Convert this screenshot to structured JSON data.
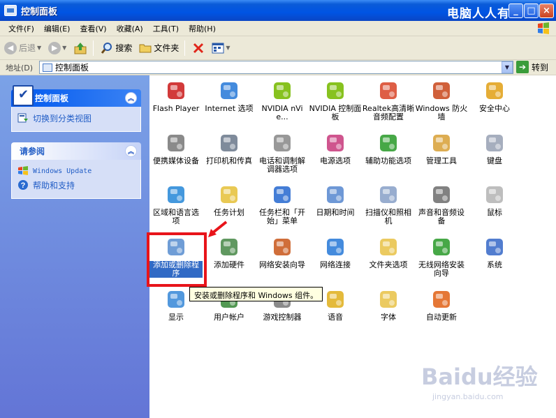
{
  "window": {
    "title": "控制面板",
    "watermark": "电脑人人有",
    "buttons": [
      "_",
      "□",
      "×"
    ]
  },
  "menu": [
    "文件(F)",
    "编辑(E)",
    "查看(V)",
    "收藏(A)",
    "工具(T)",
    "帮助(H)"
  ],
  "toolbar": {
    "back": "后退",
    "search": "搜索",
    "folders": "文件夹"
  },
  "address": {
    "label": "地址(D)",
    "value": "控制面板",
    "go": "转到"
  },
  "sidebar": {
    "panel1": {
      "title": "控制面板",
      "link": "切换到分类视图"
    },
    "panel2": {
      "title": "请参阅",
      "links": [
        "Windows Update",
        "帮助和支持"
      ]
    }
  },
  "items": [
    {
      "label": "Flash Player",
      "icon": "flash-icon",
      "color": "#cc1f1f"
    },
    {
      "label": "Internet 选项",
      "icon": "internet-options-icon",
      "color": "#2a7bd8"
    },
    {
      "label": "NVIDIA nVie...",
      "icon": "nvidia-view-icon",
      "color": "#76b900"
    },
    {
      "label": "NVIDIA 控制面板",
      "icon": "nvidia-control-icon",
      "color": "#76b900"
    },
    {
      "label": "Realtek高清晰音频配置",
      "icon": "realtek-audio-icon",
      "color": "#d9482b"
    },
    {
      "label": "Windows 防火墙",
      "icon": "firewall-icon",
      "color": "#c94a1f"
    },
    {
      "label": "安全中心",
      "icon": "security-center-icon",
      "color": "#e1a21a"
    },
    {
      "label": "便携媒体设备",
      "icon": "portable-media-icon",
      "color": "#7a7a7a"
    },
    {
      "label": "打印机和传真",
      "icon": "printer-icon",
      "color": "#6d7b8d"
    },
    {
      "label": "电话和调制解调器选项",
      "icon": "phone-modem-icon",
      "color": "#8a8a8a"
    },
    {
      "label": "电源选项",
      "icon": "power-options-icon",
      "color": "#c83d7e"
    },
    {
      "label": "辅助功能选项",
      "icon": "accessibility-icon",
      "color": "#2d9c2d"
    },
    {
      "label": "管理工具",
      "icon": "admin-tools-icon",
      "color": "#d8a23a"
    },
    {
      "label": "键盘",
      "icon": "keyboard-icon",
      "color": "#9aa3b5"
    },
    {
      "label": "区域和语言选项",
      "icon": "region-language-icon",
      "color": "#2a8ad8"
    },
    {
      "label": "任务计划",
      "icon": "scheduled-tasks-icon",
      "color": "#e6c23c"
    },
    {
      "label": "任务栏和「开始」菜单",
      "icon": "taskbar-icon",
      "color": "#2a6bd0"
    },
    {
      "label": "日期和时间",
      "icon": "date-time-icon",
      "color": "#5a8ad0"
    },
    {
      "label": "扫描仪和照相机",
      "icon": "scanner-camera-icon",
      "color": "#8aa2c8"
    },
    {
      "label": "声音和音频设备",
      "icon": "sound-icon",
      "color": "#707070"
    },
    {
      "label": "鼠标",
      "icon": "mouse-icon",
      "color": "#b5b5b5"
    },
    {
      "label": "添加或删除程序",
      "icon": "add-remove-programs-icon",
      "color": "#5b8fd0",
      "selected": true
    },
    {
      "label": "添加硬件",
      "icon": "add-hardware-icon",
      "color": "#4a8a4a"
    },
    {
      "label": "网络安装向导",
      "icon": "network-setup-icon",
      "color": "#c95a1f"
    },
    {
      "label": "网络连接",
      "icon": "network-connections-icon",
      "color": "#2a7bd8"
    },
    {
      "label": "文件夹选项",
      "icon": "folder-options-icon",
      "color": "#e8c34a"
    },
    {
      "label": "无线网络安装向导",
      "icon": "wireless-setup-icon",
      "color": "#2d9c2d"
    },
    {
      "label": "系统",
      "icon": "system-icon",
      "color": "#3a6bc8"
    },
    {
      "label": "显示",
      "icon": "display-icon",
      "color": "#3a8ad8"
    },
    {
      "label": "用户帐户",
      "icon": "user-accounts-icon",
      "color": "#3a8a3a"
    },
    {
      "label": "游戏控制器",
      "icon": "game-controller-icon",
      "color": "#7a7a7a"
    },
    {
      "label": "语音",
      "icon": "speech-icon",
      "color": "#e0b020"
    },
    {
      "label": "字体",
      "icon": "fonts-icon",
      "color": "#e8c34a"
    },
    {
      "label": "自动更新",
      "icon": "automatic-updates-icon",
      "color": "#e1641a"
    }
  ],
  "tooltip": "安装或删除程序和 Windows 组件。",
  "source_watermark": {
    "logo": "Baidu经验",
    "url": "jingyan.baidu.com"
  }
}
